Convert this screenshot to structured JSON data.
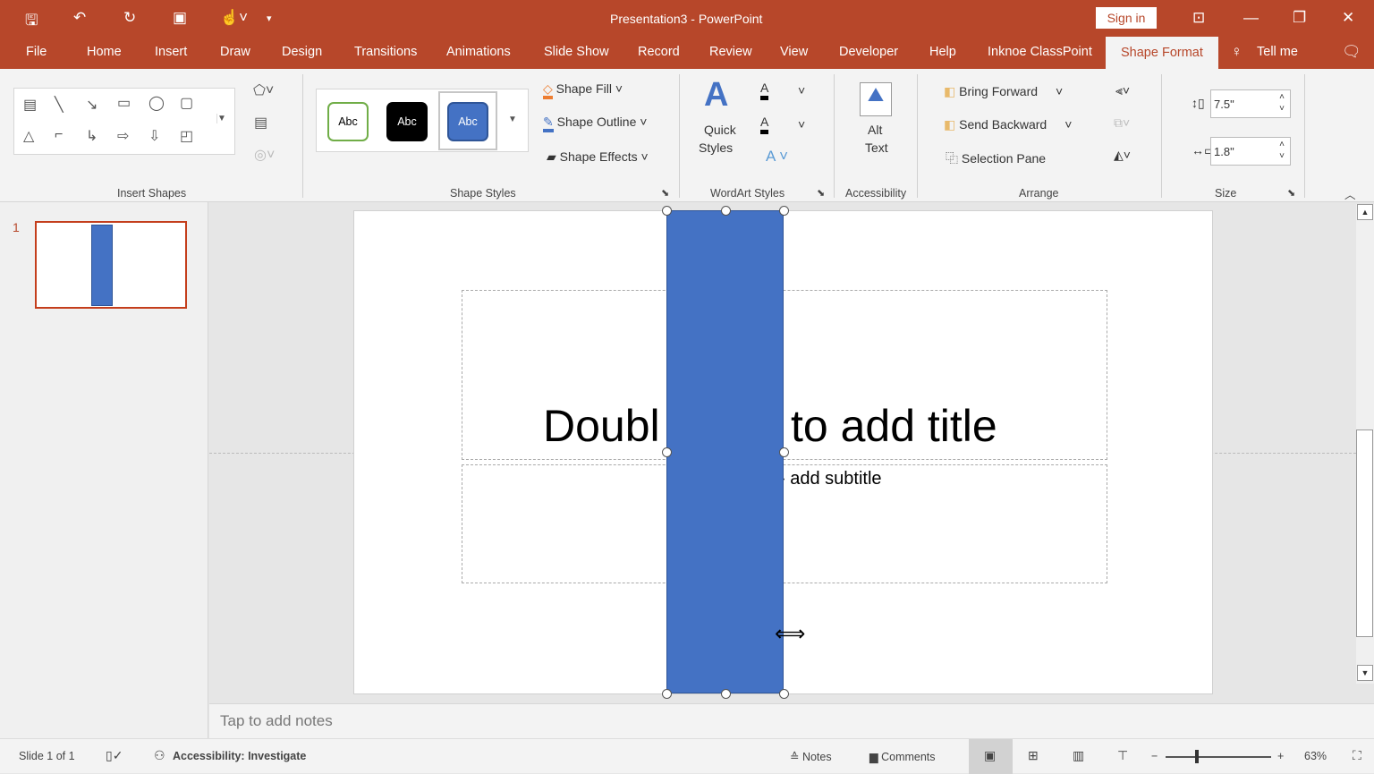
{
  "window": {
    "title": "Presentation3  -  PowerPoint",
    "sign_in": "Sign in"
  },
  "quick_access": [
    "save-icon",
    "undo-icon",
    "redo-icon",
    "present-from-start-icon",
    "touch-mode-icon",
    "customize-icon"
  ],
  "tabs": [
    "File",
    "Home",
    "Insert",
    "Draw",
    "Design",
    "Transitions",
    "Animations",
    "Slide Show",
    "Record",
    "Review",
    "View",
    "Developer",
    "Help",
    "Inknoe ClassPoint",
    "Shape Format"
  ],
  "active_tab": "Shape Format",
  "tell_me": "Tell me",
  "ribbon": {
    "insert_shapes": {
      "label": "Insert Shapes"
    },
    "shape_styles": {
      "label": "Shape Styles",
      "presets": [
        "Abc",
        "Abc",
        "Abc"
      ],
      "fill": "Shape Fill",
      "outline": "Shape Outline",
      "effects": "Shape Effects"
    },
    "wordart": {
      "label": "WordArt Styles",
      "quick_styles_1": "Quick",
      "quick_styles_2": "Styles"
    },
    "accessibility": {
      "label": "Accessibility",
      "alt_1": "Alt",
      "alt_2": "Text"
    },
    "arrange": {
      "label": "Arrange",
      "bring_forward": "Bring Forward",
      "send_backward": "Send Backward",
      "selection_pane": "Selection Pane"
    },
    "size": {
      "label": "Size",
      "height": "7.5\"",
      "width": "1.8\""
    }
  },
  "thumbnail": {
    "number": "1"
  },
  "slide": {
    "title_placeholder_left": "Doubl",
    "title_placeholder_right": "to add title",
    "subtitle_placeholder": "› add subtitle",
    "shape_color": "#4472c4"
  },
  "notes": {
    "placeholder": "Tap to add notes"
  },
  "status": {
    "slide": "Slide 1 of 1",
    "accessibility": "Accessibility: Investigate",
    "notes": "Notes",
    "comments": "Comments",
    "zoom": "63%",
    "zoom_level": 63
  },
  "colors": {
    "accent": "#b7472a",
    "shape": "#4472c4"
  }
}
